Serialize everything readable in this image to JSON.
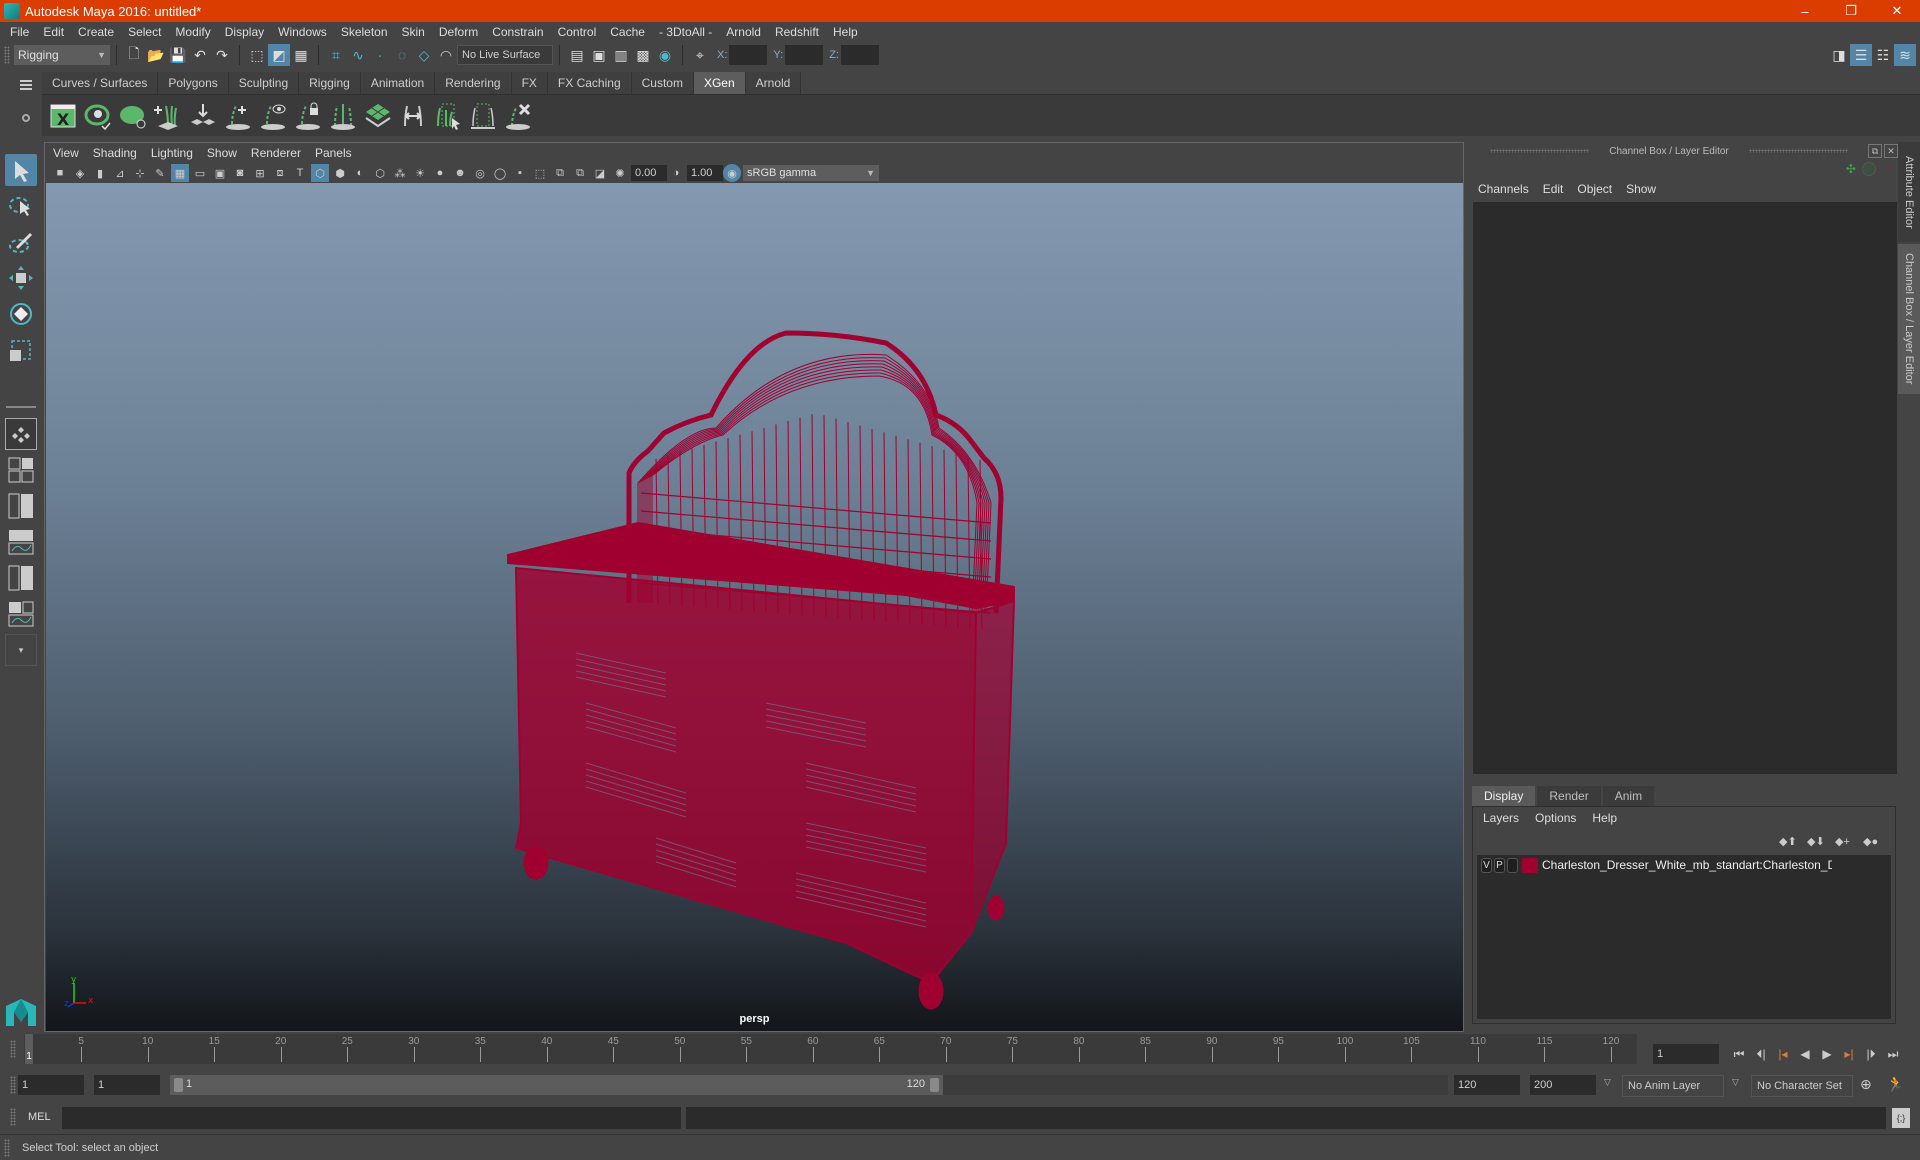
{
  "window": {
    "title": "Autodesk Maya 2016: untitled*",
    "controls": {
      "minimize": "–",
      "restore": "❐",
      "close": "✕"
    }
  },
  "menubar": {
    "items": [
      "File",
      "Edit",
      "Create",
      "Select",
      "Modify",
      "Display",
      "Windows",
      "Skeleton",
      "Skin",
      "Deform",
      "Constrain",
      "Control",
      "Cache",
      "- 3DtoAll -",
      "Arnold",
      "Redshift",
      "Help"
    ]
  },
  "statusline": {
    "menuset": "Rigging",
    "live_surface": "No Live Surface",
    "coords": {
      "x_label": "X:",
      "y_label": "Y:",
      "z_label": "Z:",
      "x_value": "",
      "y_value": "",
      "z_value": ""
    }
  },
  "shelf": {
    "tabs": [
      {
        "label": "Curves / Surfaces",
        "active": false
      },
      {
        "label": "Polygons",
        "active": false
      },
      {
        "label": "Sculpting",
        "active": false
      },
      {
        "label": "Rigging",
        "active": false
      },
      {
        "label": "Animation",
        "active": false
      },
      {
        "label": "Rendering",
        "active": false
      },
      {
        "label": "FX",
        "active": false
      },
      {
        "label": "FX Caching",
        "active": false
      },
      {
        "label": "Custom",
        "active": false
      },
      {
        "label": "XGen",
        "active": true
      },
      {
        "label": "Arnold",
        "active": false
      }
    ],
    "icons": [
      "xgen-window-icon",
      "xgen-preview-icon",
      "xgen-hide-icon",
      "add-guides-icon",
      "place-guides-icon",
      "add-guide-icon",
      "guide-visibility-icon",
      "lock-guides-icon",
      "guides-split-icon",
      "grid-guides-icon",
      "guides-flip-icon",
      "select-guides-icon",
      "guide-box-icon",
      "delete-guides-icon"
    ]
  },
  "viewport": {
    "menu": [
      "View",
      "Shading",
      "Lighting",
      "Show",
      "Renderer",
      "Panels"
    ],
    "exposure": "0.00",
    "gamma": "1.00",
    "color_space": "sRGB gamma",
    "camera_label": "persp",
    "object_color": "#a00030",
    "axis": {
      "x": "x",
      "y": "y",
      "z": "z"
    }
  },
  "channelbox": {
    "title": "Channel Box / Layer Editor",
    "menu": [
      "Channels",
      "Edit",
      "Object",
      "Show"
    ]
  },
  "layer_editor": {
    "tabs": [
      {
        "label": "Display",
        "active": true
      },
      {
        "label": "Render",
        "active": false
      },
      {
        "label": "Anim",
        "active": false
      }
    ],
    "menu": [
      "Layers",
      "Options",
      "Help"
    ],
    "layers": [
      {
        "visible": "V",
        "playback": "P",
        "name": "Charleston_Dresser_White_mb_standart:Charleston_Dres",
        "color": "#a00030"
      }
    ]
  },
  "side_tabs": [
    "Attribute Editor",
    "Channel Box / Layer Editor"
  ],
  "timeslider": {
    "ticks": [
      5,
      10,
      15,
      20,
      25,
      30,
      35,
      40,
      45,
      50,
      55,
      60,
      65,
      70,
      75,
      80,
      85,
      90,
      95,
      100,
      105,
      110,
      115,
      120
    ],
    "start": 1,
    "end": 120,
    "current_frame": "1"
  },
  "rangeslider": {
    "start_time": "1",
    "playback_start": "1",
    "range_start_label": "1",
    "range_end_label": "120",
    "playback_end": "120",
    "end_time": "200",
    "anim_layer": "No Anim Layer",
    "character_set": "No Character Set"
  },
  "cmdline": {
    "label": "MEL",
    "value": "",
    "result": ""
  },
  "helpline": {
    "text": "Select Tool: select an object"
  }
}
